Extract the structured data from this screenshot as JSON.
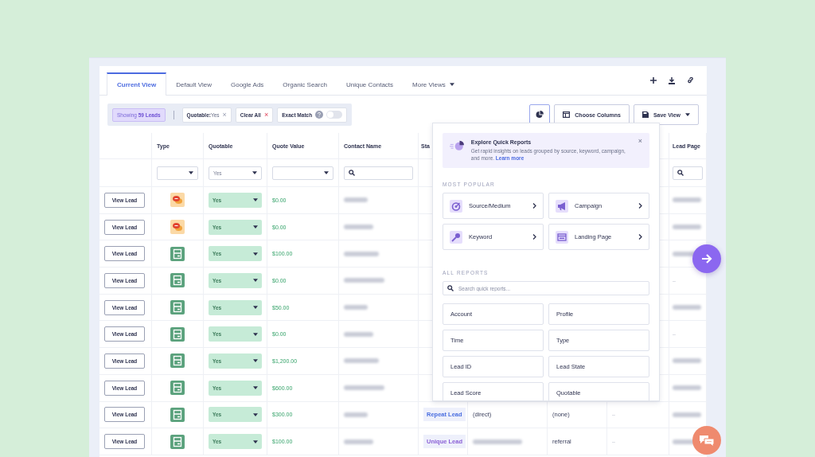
{
  "tabs": [
    {
      "label": "Current View",
      "selected": true
    },
    {
      "label": "Default View",
      "selected": false
    },
    {
      "label": "Google Ads",
      "selected": false
    },
    {
      "label": "Organic Search",
      "selected": false
    },
    {
      "label": "Unique Contacts",
      "selected": false
    },
    {
      "label": "More Views",
      "selected": false,
      "dropdown": true
    }
  ],
  "filters": {
    "showing_prefix": "Showing",
    "showing_count": "59 Leads",
    "chips": [
      {
        "label": "Quotable:",
        "value": "Yes",
        "remove": "×",
        "kind": "filter"
      },
      {
        "label": "Clear All",
        "remove": "×",
        "kind": "clear"
      }
    ],
    "exact_match": {
      "label": "Exact Match",
      "on": false
    }
  },
  "actions": {
    "choose_columns": "Choose Columns",
    "save_view": "Save View"
  },
  "table": {
    "columns": [
      "Type",
      "Quotable",
      "Quote Value",
      "Contact Name",
      "Sta",
      "Lead Page"
    ],
    "filter_row": {
      "quotable": "Yes"
    },
    "rows": [
      {
        "button": "View Lead",
        "kind": "chat",
        "quotable": "Yes",
        "quote_value": "$0.00",
        "lead_page_redacted": true
      },
      {
        "button": "View Lead",
        "kind": "chat",
        "quotable": "Yes",
        "quote_value": "$0.00",
        "lead_page_redacted": true
      },
      {
        "button": "View Lead",
        "kind": "form",
        "quotable": "Yes",
        "quote_value": "$100.00",
        "lead_page_redacted": true
      },
      {
        "button": "View Lead",
        "kind": "form",
        "quotable": "Yes",
        "quote_value": "$0.00",
        "lead_page": "–"
      },
      {
        "button": "View Lead",
        "kind": "form",
        "quotable": "Yes",
        "quote_value": "$50.00",
        "lead_page_redacted": true
      },
      {
        "button": "View Lead",
        "kind": "form",
        "quotable": "Yes",
        "quote_value": "$0.00",
        "lead_page": "–"
      },
      {
        "button": "View Lead",
        "kind": "form",
        "quotable": "Yes",
        "quote_value": "$1,200.00",
        "lead_page_redacted": true
      },
      {
        "button": "View Lead",
        "kind": "form",
        "quotable": "Yes",
        "quote_value": "$600.00",
        "lead_page_redacted": true
      },
      {
        "button": "View Lead",
        "kind": "form",
        "quotable": "Yes",
        "quote_value": "$300.00",
        "status": {
          "label": "Repeat Lead",
          "color": "#4a6ee0"
        },
        "source": "(direct)",
        "medium": "(none)",
        "column_9": "–",
        "lead_page_redacted": true
      },
      {
        "button": "View Lead",
        "kind": "form",
        "quotable": "Yes",
        "quote_value": "$100.00",
        "status": {
          "label": "Unique Lead",
          "color": "#8a5fd6"
        },
        "source_redacted": true,
        "medium": "referral",
        "column_9": "–",
        "lead_page_redacted": true
      }
    ]
  },
  "quick_reports": {
    "banner": {
      "title": "Explore Quick Reports",
      "text": "Get rapid insights on leads grouped by source, keyword, campaign, and more.",
      "link": "Learn more",
      "close": "×"
    },
    "popular_heading": "MOST POPULAR",
    "popular": [
      {
        "label": "Source/Medium",
        "kind": "target"
      },
      {
        "label": "Campaign",
        "kind": "megaphone"
      },
      {
        "label": "Keyword",
        "kind": "key"
      },
      {
        "label": "Landing Page",
        "kind": "page"
      }
    ],
    "all_heading": "ALL REPORTS",
    "search": {
      "placeholder": "Search quick reports..."
    },
    "all": [
      "Account",
      "Profile",
      "Time",
      "Type",
      "Lead ID",
      "Lead State",
      "Lead Score",
      "Quotable"
    ]
  }
}
